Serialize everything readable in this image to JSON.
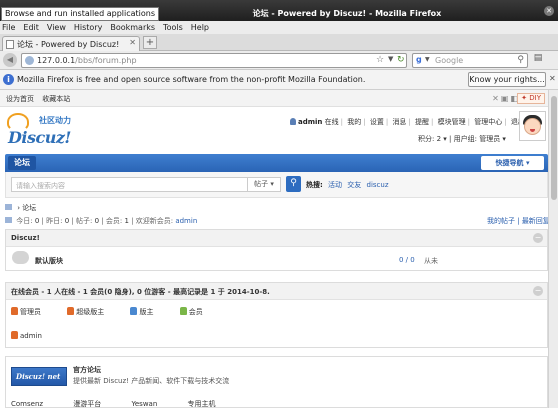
{
  "window": {
    "tooltip": "Browse and run installed applications",
    "title": "论坛 - Powered by Discuz! - Mozilla Firefox"
  },
  "menubar": [
    "File",
    "Edit",
    "View",
    "History",
    "Bookmarks",
    "Tools",
    "Help"
  ],
  "tab": {
    "label": "论坛 - Powered by Discuz!"
  },
  "urlbar": {
    "host": "127.0.0.1",
    "path": "/bbs/forum.php"
  },
  "search": {
    "placeholder": "Google"
  },
  "notification": {
    "message": "Mozilla Firefox is free and open source software from the non-profit Mozilla Foundation.",
    "button": "Know your rights..."
  },
  "site": {
    "topbar": {
      "sethome": "设为首页",
      "favorite": "收藏本站",
      "diy": "DIY"
    },
    "logo": {
      "slogan": "社区动力",
      "word": "Discuz!"
    },
    "user": {
      "name": "admin",
      "status": "在线",
      "links": [
        "我的",
        "设置",
        "消息",
        "提醒",
        "模块管理",
        "管理中心",
        "退出"
      ],
      "points_label": "积分: 2",
      "group_label": "用户组: 管理员"
    },
    "nav": {
      "forum_tab": "论坛",
      "quick_nav": "快捷导航"
    },
    "searchbox": {
      "placeholder": "请输入搜索内容",
      "type": "帖子",
      "hot_label": "热搜:",
      "hot": [
        "活动",
        "交友",
        "discuz"
      ]
    },
    "breadcrumb": "论坛",
    "stats": {
      "today_label": "今日:",
      "today": "0",
      "yesterday_label": "昨日:",
      "yesterday": "0",
      "posts_label": "帖子:",
      "posts": "0",
      "members_label": "会员:",
      "members": "1",
      "newest_label": "欢迎新会员:",
      "newest": "admin",
      "my_posts": "我的帖子",
      "newest_replies": "最新回复"
    },
    "category": {
      "title": "Discuz!",
      "forum_name": "默认版块",
      "count": "0 / 0",
      "last": "从未"
    },
    "online": {
      "title": "在线会员 - 1 人在线 - 1 会员(0 隐身), 0 位游客 - 最高记录是 1 于 2014-10-8.",
      "groups": [
        {
          "label": "管理员",
          "color": "#e06a2a"
        },
        {
          "label": "超级版主",
          "color": "#e06a2a"
        },
        {
          "label": "版主",
          "color": "#4a88d0"
        },
        {
          "label": "会员",
          "color": "#7ab648"
        }
      ],
      "member": "admin"
    },
    "links": {
      "banner_text": "Discuz! net",
      "title": "官方论坛",
      "desc": "提供最新 Discuz! 产品新闻、软件下载与技术交流",
      "row": [
        "Comsenz",
        "漫游平台",
        "Yeswan",
        "专用主机"
      ]
    }
  }
}
